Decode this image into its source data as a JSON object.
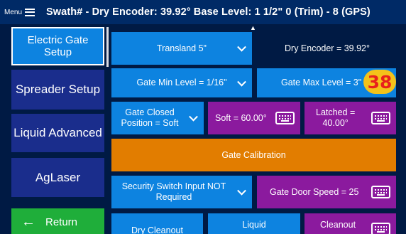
{
  "header": {
    "menu_label": "Menu",
    "title": "Swath# -   Dry Encoder: 39.92°   Base Level: 1 1/2\"  0 (Trim) - 8 (GPS)"
  },
  "sidebar": {
    "items": [
      {
        "label": "Electric Gate Setup"
      },
      {
        "label": "Spreader Setup"
      },
      {
        "label": "Liquid Advanced"
      },
      {
        "label": "AgLaser"
      }
    ],
    "return_label": "Return"
  },
  "main": {
    "transland": "Transland 5\"",
    "dry_encoder": "Dry Encoder = 39.92°",
    "gate_min": "Gate Min Level = 1/16\"",
    "gate_max": "Gate Max Level = 3\"",
    "badge": "38",
    "gate_closed_line1": "Gate Closed",
    "gate_closed_line2": "Position = Soft",
    "soft": "Soft = 60.00°",
    "latched_line1": "Latched =",
    "latched_line2": "40.00°",
    "gate_calibration": "Gate Calibration",
    "security_line1": "Security Switch Input NOT",
    "security_line2": "Required",
    "gate_door_speed": "Gate Door Speed = 25",
    "dry_cleanout": "Dry Cleanout",
    "liquid": "Liquid",
    "cleanout": "Cleanout"
  },
  "colors": {
    "background": "#001a44",
    "header": "#002a66",
    "blue": "#0d83e0",
    "purple": "#8b1a9e",
    "orange": "#e27d00",
    "green": "#1fae3a",
    "nav": "#1a2d8c",
    "badge": "#f4c21a",
    "badge_text": "#e8211c"
  },
  "icons": [
    "hamburger-menu-icon",
    "left-arrow-icon",
    "chevron-down-icon",
    "keyboard-icon",
    "scroll-up-arrow-icon"
  ]
}
